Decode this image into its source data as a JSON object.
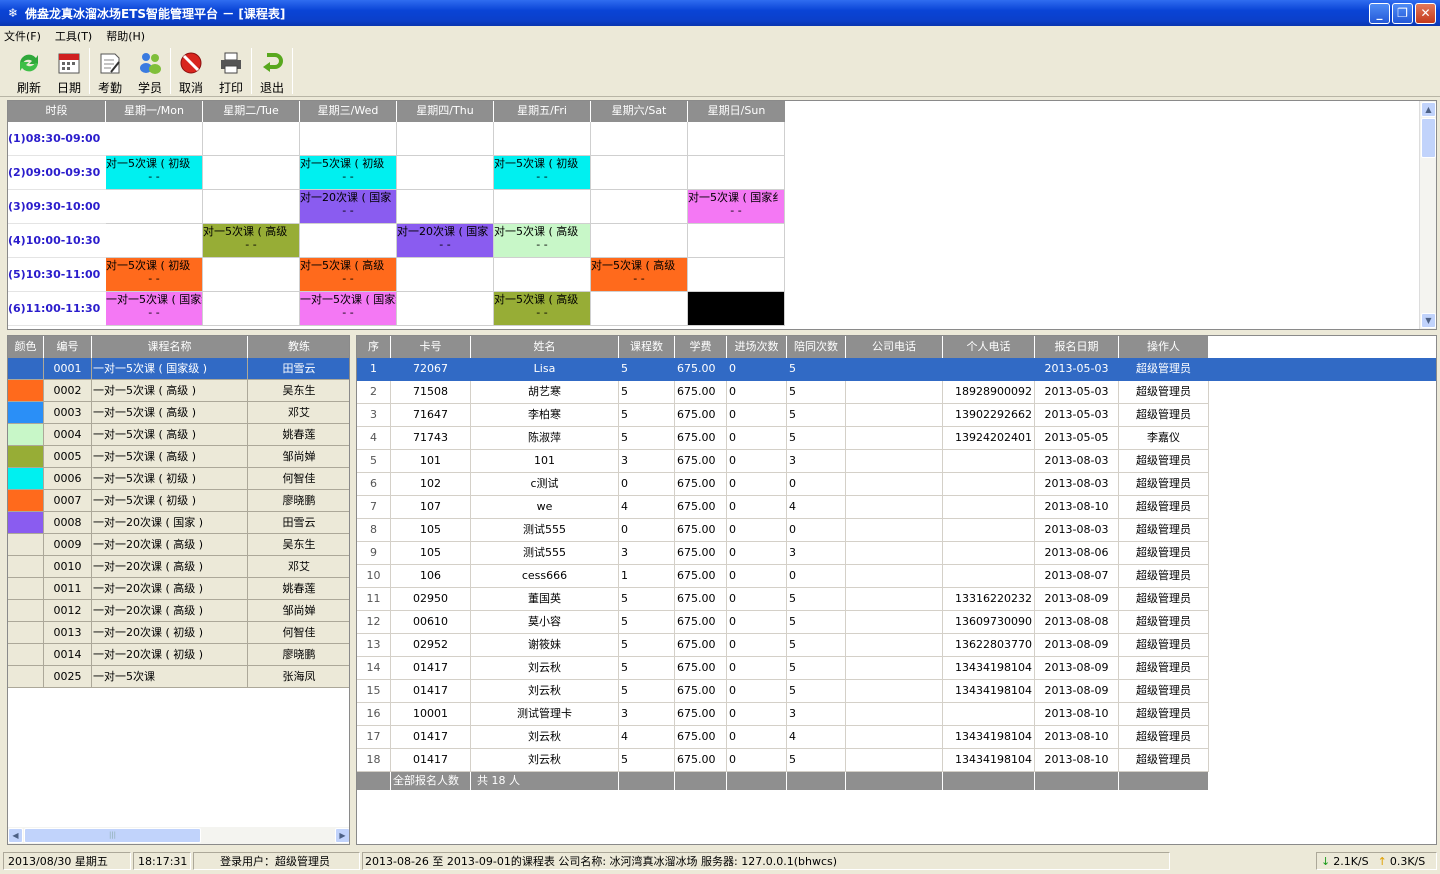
{
  "window": {
    "title": "佛盎龙真冰溜冰场ETS智能管理平台 － [课程表]",
    "minimize": "_",
    "restore": "❐",
    "close": "✕"
  },
  "menu": [
    "文件(F)",
    "工具(T)",
    "帮助(H)"
  ],
  "toolbar": {
    "refresh": "刷新",
    "date": "日期",
    "attendance": "考勤",
    "student": "学员",
    "cancel": "取消",
    "print": "打印",
    "exit": "退出"
  },
  "timetable": {
    "headers": [
      "时段",
      "星期一/Mon",
      "星期二/Tue",
      "星期三/Wed",
      "星期四/Thu",
      "星期五/Fri",
      "星期六/Sat",
      "星期日/Sun"
    ],
    "slots": [
      "(1)08:30-09:00",
      "(2)09:00-09:30",
      "(3)09:30-10:00",
      "(4)10:00-10:30",
      "(5)10:30-11:00",
      "(6)11:00-11:30"
    ],
    "cells": [
      {
        "slot": 1,
        "day": 0,
        "text": "对一5次课 ( 初级",
        "sub": "- -",
        "color": "#00f0f0"
      },
      {
        "slot": 1,
        "day": 2,
        "text": "对一5次课 ( 初级",
        "sub": "- -",
        "color": "#00f0f0"
      },
      {
        "slot": 1,
        "day": 4,
        "text": "对一5次课 ( 初级",
        "sub": "- -",
        "color": "#00f0f0"
      },
      {
        "slot": 2,
        "day": 2,
        "text": "对一20次课 ( 国家",
        "sub": "- -",
        "color": "#8a5cf0"
      },
      {
        "slot": 2,
        "day": 6,
        "text": "对一5次课 ( 国家纟",
        "sub": "- -",
        "color": "#f478f4"
      },
      {
        "slot": 3,
        "day": 1,
        "text": "对一5次课 ( 高级",
        "sub": "- -",
        "color": "#97ad36"
      },
      {
        "slot": 3,
        "day": 3,
        "text": "对一20次课 ( 国家",
        "sub": "- -",
        "color": "#8a5cf0"
      },
      {
        "slot": 3,
        "day": 4,
        "text": "对一5次课 ( 高级",
        "sub": "- -",
        "color": "#c8f7c8"
      },
      {
        "slot": 4,
        "day": 0,
        "text": "对一5次课 ( 初级",
        "sub": "- -",
        "color": "#ff6a1c"
      },
      {
        "slot": 4,
        "day": 2,
        "text": "对一5次课 ( 高级",
        "sub": "- -",
        "color": "#ff6a1c"
      },
      {
        "slot": 4,
        "day": 5,
        "text": "对一5次课 ( 高级",
        "sub": "- -",
        "color": "#ff6a1c"
      },
      {
        "slot": 5,
        "day": 0,
        "text": "一对一5次课 ( 国家级",
        "sub": "- -",
        "color": "#f478f4"
      },
      {
        "slot": 5,
        "day": 2,
        "text": "一对一5次课 ( 国家级",
        "sub": "- -",
        "color": "#f478f4"
      },
      {
        "slot": 5,
        "day": 4,
        "text": "对一5次课 ( 高级",
        "sub": "- -",
        "color": "#97ad36"
      },
      {
        "slot": 5,
        "day": 6,
        "text": "",
        "sub": "",
        "color": "#000000"
      }
    ]
  },
  "courses": {
    "headers": [
      "颜色",
      "编号",
      "课程名称",
      "教练"
    ],
    "rows": [
      {
        "color": "#316ac5",
        "id": "0001",
        "name": "一对一5次课 ( 国家级 )",
        "coach": "田雪云",
        "selected": true
      },
      {
        "color": "#ff6a1c",
        "id": "0002",
        "name": "一对一5次课 ( 高级 )",
        "coach": "吴东生"
      },
      {
        "color": "#2a8ff7",
        "id": "0003",
        "name": "一对一5次课 ( 高级 )",
        "coach": "邓艾"
      },
      {
        "color": "#c8f7c8",
        "id": "0004",
        "name": "一对一5次课 ( 高级 )",
        "coach": "姚春莲"
      },
      {
        "color": "#97ad36",
        "id": "0005",
        "name": "一对一5次课 ( 高级 )",
        "coach": "邹尚婵"
      },
      {
        "color": "#00f0f0",
        "id": "0006",
        "name": "一对一5次课 ( 初级 )",
        "coach": "何智佳"
      },
      {
        "color": "#ff6a1c",
        "id": "0007",
        "name": "一对一5次课 ( 初级 )",
        "coach": "廖晓鹏"
      },
      {
        "color": "#8a5cf0",
        "id": "0008",
        "name": "一对一20次课 ( 国家 )",
        "coach": "田雪云"
      },
      {
        "color": "",
        "id": "0009",
        "name": "一对一20次课 ( 高级 )",
        "coach": "吴东生"
      },
      {
        "color": "",
        "id": "0010",
        "name": "一对一20次课 ( 高级 )",
        "coach": "邓艾"
      },
      {
        "color": "",
        "id": "0011",
        "name": "一对一20次课 ( 高级 )",
        "coach": "姚春莲"
      },
      {
        "color": "",
        "id": "0012",
        "name": "一对一20次课 ( 高级 )",
        "coach": "邹尚婵"
      },
      {
        "color": "",
        "id": "0013",
        "name": "一对一20次课 ( 初级 )",
        "coach": "何智佳"
      },
      {
        "color": "",
        "id": "0014",
        "name": "一对一20次课 ( 初级 )",
        "coach": "廖晓鹏"
      },
      {
        "color": "",
        "id": "0025",
        "name": "一对一5次课",
        "coach": "张海凤"
      }
    ]
  },
  "students": {
    "headers": [
      "序",
      "卡号",
      "姓名",
      "课程数",
      "学费",
      "进场次数",
      "陪同次数",
      "公司电话",
      "个人电话",
      "报名日期",
      "操作人"
    ],
    "rows": [
      [
        "1",
        "72067",
        "Lisa",
        "5",
        "675.00",
        "0",
        "5",
        "",
        "",
        "2013-05-03",
        "超级管理员"
      ],
      [
        "2",
        "71508",
        "胡艺寒",
        "5",
        "675.00",
        "0",
        "5",
        "",
        "18928900092",
        "2013-05-03",
        "超级管理员"
      ],
      [
        "3",
        "71647",
        "李柏寒",
        "5",
        "675.00",
        "0",
        "5",
        "",
        "13902292662",
        "2013-05-03",
        "超级管理员"
      ],
      [
        "4",
        "71743",
        "陈淑萍",
        "5",
        "675.00",
        "0",
        "5",
        "",
        "13924202401",
        "2013-05-05",
        "李嘉仪"
      ],
      [
        "5",
        "101",
        "101",
        "3",
        "675.00",
        "0",
        "3",
        "",
        "",
        "2013-08-03",
        "超级管理员"
      ],
      [
        "6",
        "102",
        "c测试",
        "0",
        "675.00",
        "0",
        "0",
        "",
        "",
        "2013-08-03",
        "超级管理员"
      ],
      [
        "7",
        "107",
        "we",
        "4",
        "675.00",
        "0",
        "4",
        "",
        "",
        "2013-08-10",
        "超级管理员"
      ],
      [
        "8",
        "105",
        "测试555",
        "0",
        "675.00",
        "0",
        "0",
        "",
        "",
        "2013-08-03",
        "超级管理员"
      ],
      [
        "9",
        "105",
        "测试555",
        "3",
        "675.00",
        "0",
        "3",
        "",
        "",
        "2013-08-06",
        "超级管理员"
      ],
      [
        "10",
        "106",
        "cess666",
        "1",
        "675.00",
        "0",
        "0",
        "",
        "",
        "2013-08-07",
        "超级管理员"
      ],
      [
        "11",
        "02950",
        "董国英",
        "5",
        "675.00",
        "0",
        "5",
        "",
        "13316220232",
        "2013-08-09",
        "超级管理员"
      ],
      [
        "12",
        "00610",
        "莫小容",
        "5",
        "675.00",
        "0",
        "5",
        "",
        "13609730090",
        "2013-08-08",
        "超级管理员"
      ],
      [
        "13",
        "02952",
        "谢筱妹",
        "5",
        "675.00",
        "0",
        "5",
        "",
        "13622803770",
        "2013-08-09",
        "超级管理员"
      ],
      [
        "14",
        "01417",
        "刘云秋",
        "5",
        "675.00",
        "0",
        "5",
        "",
        "13434198104",
        "2013-08-09",
        "超级管理员"
      ],
      [
        "15",
        "01417",
        "刘云秋",
        "5",
        "675.00",
        "0",
        "5",
        "",
        "13434198104",
        "2013-08-09",
        "超级管理员"
      ],
      [
        "16",
        "10001",
        "测试管理卡",
        "3",
        "675.00",
        "0",
        "3",
        "",
        "",
        "2013-08-10",
        "超级管理员"
      ],
      [
        "17",
        "01417",
        "刘云秋",
        "4",
        "675.00",
        "0",
        "4",
        "",
        "13434198104",
        "2013-08-10",
        "超级管理员"
      ],
      [
        "18",
        "01417",
        "刘云秋",
        "5",
        "675.00",
        "0",
        "5",
        "",
        "13434198104",
        "2013-08-10",
        "超级管理员"
      ]
    ],
    "footer_label": "全部报名人数",
    "footer_total": "共 18 人"
  },
  "status": {
    "date": "2013/08/30 星期五",
    "time": "18:17:31",
    "user": "登录用户：超级管理员",
    "info": "2013-08-26 至 2013-09-01的课程表 公司名称: 冰河湾真冰溜冰场 服务器: 127.0.0.1(bhwcs)",
    "down": "2.1K/S",
    "up": "0.3K/S"
  }
}
